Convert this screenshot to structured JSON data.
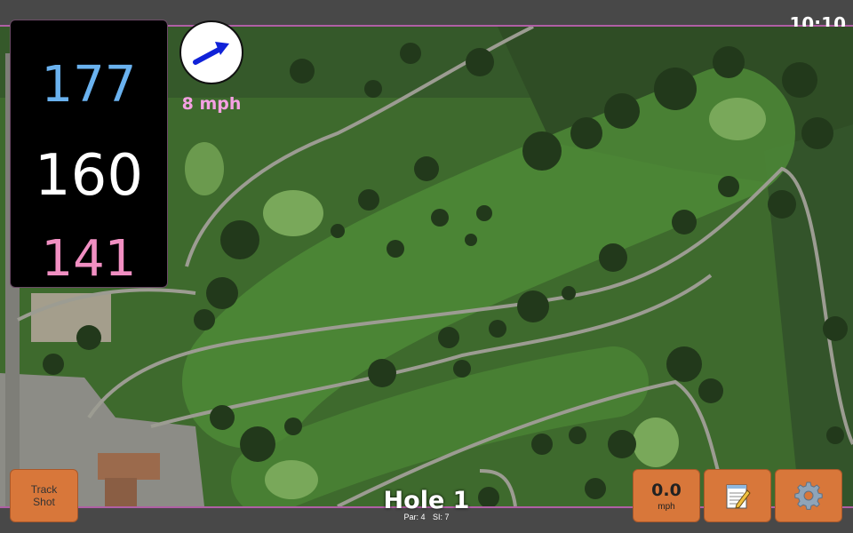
{
  "status_bar": {
    "time": "10:10"
  },
  "distances": {
    "back": "177",
    "center": "160",
    "front": "141"
  },
  "wind": {
    "speed": "8 mph",
    "direction_icon": "arrow-right-up-icon"
  },
  "hole": {
    "title": "Hole 1",
    "par": "Par: 4",
    "stroke_index": "SI: 7"
  },
  "buttons": {
    "track_shot": "Track Shot",
    "speed_value": "0.0",
    "speed_unit": "mph",
    "notes_icon": "notepad-icon",
    "settings_icon": "gear-icon"
  },
  "colors": {
    "back_distance": "#6ab2ef",
    "center_distance": "#ffffff",
    "front_distance": "#f18fc2",
    "wind_text": "#f5a0e3",
    "button_orange": "#d8773a",
    "accent_border": "#b05fa5"
  }
}
